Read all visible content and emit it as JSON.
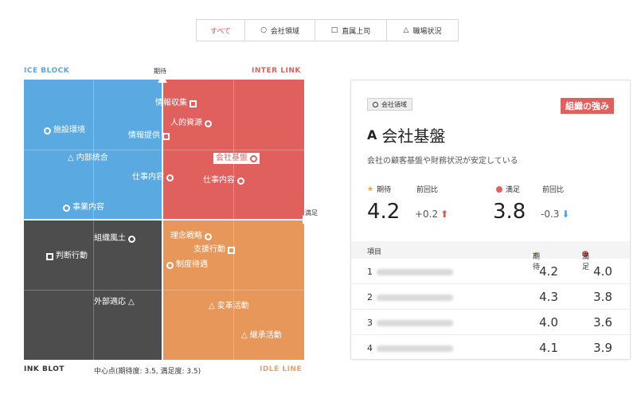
{
  "filters": {
    "all": "すべて",
    "company": "会社領域",
    "boss": "直属上司",
    "workplace": "職場状況",
    "company_symbol": "○",
    "boss_symbol": "□",
    "workplace_symbol": "△"
  },
  "chart": {
    "corner_tl": "ICE BLOCK",
    "corner_tr": "INTER LINK",
    "corner_bl": "INK BLOT",
    "corner_br": "IDLE LINE",
    "center_info": "中心点(期待度: 3.5, 満足度: 3.5)",
    "y_axis_label": "期待",
    "x_axis_label": "満足"
  },
  "chart_data": {
    "type": "scatter",
    "title": "",
    "xlabel": "満足",
    "ylabel": "期待",
    "center": [
      3.5,
      3.5
    ],
    "points": [
      {
        "label": "情報収集",
        "shape": "square"
      },
      {
        "label": "人的資源",
        "shape": "circle"
      },
      {
        "label": "施設環境",
        "shape": "circle"
      },
      {
        "label": "情報提供",
        "shape": "square"
      },
      {
        "label": "内部統合",
        "shape": "triangle"
      },
      {
        "label": "会社基盤",
        "shape": "circle",
        "selected": true
      },
      {
        "label": "仕事内容",
        "shape": "circle"
      },
      {
        "label": "仕事内容",
        "shape": "circle"
      },
      {
        "label": "事業内容",
        "shape": "circle"
      },
      {
        "label": "組織風土",
        "shape": "circle"
      },
      {
        "label": "判断行動",
        "shape": "square"
      },
      {
        "label": "理念戦略",
        "shape": "circle"
      },
      {
        "label": "支援行動",
        "shape": "square"
      },
      {
        "label": "制度待遇",
        "shape": "circle"
      },
      {
        "label": "外部適応",
        "shape": "triangle"
      },
      {
        "label": "変革活動",
        "shape": "triangle"
      },
      {
        "label": "継承活動",
        "shape": "triangle"
      }
    ]
  },
  "panel": {
    "category": "会社領域",
    "strength_badge": "組織の強み",
    "title_letter": "A",
    "title": "会社基盤",
    "description": "会社の顧客基盤や財務状況が安定している",
    "expect_label": "期待",
    "satisfy_label": "満足",
    "prev_label": "前回比",
    "expect_value": "4.2",
    "expect_delta": "+0.2",
    "satisfy_value": "3.8",
    "satisfy_delta": "-0.3",
    "colors": {
      "accent": "#e0605e",
      "star": "#f2a43a",
      "down": "#4fa3e0"
    },
    "table": {
      "col_item": "項目",
      "col_expect": "期待",
      "col_satisfy": "満足",
      "rows": [
        {
          "no": "1",
          "expect": "4.2",
          "satisfy": "4.0"
        },
        {
          "no": "2",
          "expect": "4.3",
          "satisfy": "3.8"
        },
        {
          "no": "3",
          "expect": "4.0",
          "satisfy": "3.6"
        },
        {
          "no": "4",
          "expect": "4.1",
          "satisfy": "3.9"
        }
      ]
    }
  }
}
